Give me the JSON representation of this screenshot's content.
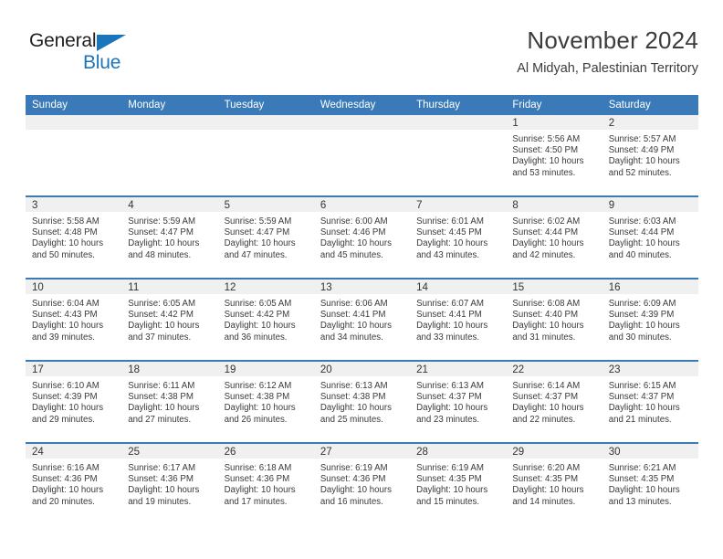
{
  "logo": {
    "word1": "General",
    "word2": "Blue",
    "triangle_color": "#1b75bb",
    "word1_color": "#231f20",
    "word2_color": "#1b75bb"
  },
  "header": {
    "month_title": "November 2024",
    "location": "Al Midyah, Palestinian Territory"
  },
  "theme": {
    "header_blue": "#3a7ab8",
    "daystrip_gray": "#f0f0f0",
    "text_color": "#3a3a3a"
  },
  "weekday_headers": [
    "Sunday",
    "Monday",
    "Tuesday",
    "Wednesday",
    "Thursday",
    "Friday",
    "Saturday"
  ],
  "weeks": [
    [
      {
        "day": "",
        "sunrise": "",
        "sunset": "",
        "daylight": "",
        "empty": true
      },
      {
        "day": "",
        "sunrise": "",
        "sunset": "",
        "daylight": "",
        "empty": true
      },
      {
        "day": "",
        "sunrise": "",
        "sunset": "",
        "daylight": "",
        "empty": true
      },
      {
        "day": "",
        "sunrise": "",
        "sunset": "",
        "daylight": "",
        "empty": true
      },
      {
        "day": "",
        "sunrise": "",
        "sunset": "",
        "daylight": "",
        "empty": true
      },
      {
        "day": "1",
        "sunrise": "Sunrise: 5:56 AM",
        "sunset": "Sunset: 4:50 PM",
        "daylight": "Daylight: 10 hours and 53 minutes.",
        "empty": false
      },
      {
        "day": "2",
        "sunrise": "Sunrise: 5:57 AM",
        "sunset": "Sunset: 4:49 PM",
        "daylight": "Daylight: 10 hours and 52 minutes.",
        "empty": false
      }
    ],
    [
      {
        "day": "3",
        "sunrise": "Sunrise: 5:58 AM",
        "sunset": "Sunset: 4:48 PM",
        "daylight": "Daylight: 10 hours and 50 minutes.",
        "empty": false
      },
      {
        "day": "4",
        "sunrise": "Sunrise: 5:59 AM",
        "sunset": "Sunset: 4:47 PM",
        "daylight": "Daylight: 10 hours and 48 minutes.",
        "empty": false
      },
      {
        "day": "5",
        "sunrise": "Sunrise: 5:59 AM",
        "sunset": "Sunset: 4:47 PM",
        "daylight": "Daylight: 10 hours and 47 minutes.",
        "empty": false
      },
      {
        "day": "6",
        "sunrise": "Sunrise: 6:00 AM",
        "sunset": "Sunset: 4:46 PM",
        "daylight": "Daylight: 10 hours and 45 minutes.",
        "empty": false
      },
      {
        "day": "7",
        "sunrise": "Sunrise: 6:01 AM",
        "sunset": "Sunset: 4:45 PM",
        "daylight": "Daylight: 10 hours and 43 minutes.",
        "empty": false
      },
      {
        "day": "8",
        "sunrise": "Sunrise: 6:02 AM",
        "sunset": "Sunset: 4:44 PM",
        "daylight": "Daylight: 10 hours and 42 minutes.",
        "empty": false
      },
      {
        "day": "9",
        "sunrise": "Sunrise: 6:03 AM",
        "sunset": "Sunset: 4:44 PM",
        "daylight": "Daylight: 10 hours and 40 minutes.",
        "empty": false
      }
    ],
    [
      {
        "day": "10",
        "sunrise": "Sunrise: 6:04 AM",
        "sunset": "Sunset: 4:43 PM",
        "daylight": "Daylight: 10 hours and 39 minutes.",
        "empty": false
      },
      {
        "day": "11",
        "sunrise": "Sunrise: 6:05 AM",
        "sunset": "Sunset: 4:42 PM",
        "daylight": "Daylight: 10 hours and 37 minutes.",
        "empty": false
      },
      {
        "day": "12",
        "sunrise": "Sunrise: 6:05 AM",
        "sunset": "Sunset: 4:42 PM",
        "daylight": "Daylight: 10 hours and 36 minutes.",
        "empty": false
      },
      {
        "day": "13",
        "sunrise": "Sunrise: 6:06 AM",
        "sunset": "Sunset: 4:41 PM",
        "daylight": "Daylight: 10 hours and 34 minutes.",
        "empty": false
      },
      {
        "day": "14",
        "sunrise": "Sunrise: 6:07 AM",
        "sunset": "Sunset: 4:41 PM",
        "daylight": "Daylight: 10 hours and 33 minutes.",
        "empty": false
      },
      {
        "day": "15",
        "sunrise": "Sunrise: 6:08 AM",
        "sunset": "Sunset: 4:40 PM",
        "daylight": "Daylight: 10 hours and 31 minutes.",
        "empty": false
      },
      {
        "day": "16",
        "sunrise": "Sunrise: 6:09 AM",
        "sunset": "Sunset: 4:39 PM",
        "daylight": "Daylight: 10 hours and 30 minutes.",
        "empty": false
      }
    ],
    [
      {
        "day": "17",
        "sunrise": "Sunrise: 6:10 AM",
        "sunset": "Sunset: 4:39 PM",
        "daylight": "Daylight: 10 hours and 29 minutes.",
        "empty": false
      },
      {
        "day": "18",
        "sunrise": "Sunrise: 6:11 AM",
        "sunset": "Sunset: 4:38 PM",
        "daylight": "Daylight: 10 hours and 27 minutes.",
        "empty": false
      },
      {
        "day": "19",
        "sunrise": "Sunrise: 6:12 AM",
        "sunset": "Sunset: 4:38 PM",
        "daylight": "Daylight: 10 hours and 26 minutes.",
        "empty": false
      },
      {
        "day": "20",
        "sunrise": "Sunrise: 6:13 AM",
        "sunset": "Sunset: 4:38 PM",
        "daylight": "Daylight: 10 hours and 25 minutes.",
        "empty": false
      },
      {
        "day": "21",
        "sunrise": "Sunrise: 6:13 AM",
        "sunset": "Sunset: 4:37 PM",
        "daylight": "Daylight: 10 hours and 23 minutes.",
        "empty": false
      },
      {
        "day": "22",
        "sunrise": "Sunrise: 6:14 AM",
        "sunset": "Sunset: 4:37 PM",
        "daylight": "Daylight: 10 hours and 22 minutes.",
        "empty": false
      },
      {
        "day": "23",
        "sunrise": "Sunrise: 6:15 AM",
        "sunset": "Sunset: 4:37 PM",
        "daylight": "Daylight: 10 hours and 21 minutes.",
        "empty": false
      }
    ],
    [
      {
        "day": "24",
        "sunrise": "Sunrise: 6:16 AM",
        "sunset": "Sunset: 4:36 PM",
        "daylight": "Daylight: 10 hours and 20 minutes.",
        "empty": false
      },
      {
        "day": "25",
        "sunrise": "Sunrise: 6:17 AM",
        "sunset": "Sunset: 4:36 PM",
        "daylight": "Daylight: 10 hours and 19 minutes.",
        "empty": false
      },
      {
        "day": "26",
        "sunrise": "Sunrise: 6:18 AM",
        "sunset": "Sunset: 4:36 PM",
        "daylight": "Daylight: 10 hours and 17 minutes.",
        "empty": false
      },
      {
        "day": "27",
        "sunrise": "Sunrise: 6:19 AM",
        "sunset": "Sunset: 4:36 PM",
        "daylight": "Daylight: 10 hours and 16 minutes.",
        "empty": false
      },
      {
        "day": "28",
        "sunrise": "Sunrise: 6:19 AM",
        "sunset": "Sunset: 4:35 PM",
        "daylight": "Daylight: 10 hours and 15 minutes.",
        "empty": false
      },
      {
        "day": "29",
        "sunrise": "Sunrise: 6:20 AM",
        "sunset": "Sunset: 4:35 PM",
        "daylight": "Daylight: 10 hours and 14 minutes.",
        "empty": false
      },
      {
        "day": "30",
        "sunrise": "Sunrise: 6:21 AM",
        "sunset": "Sunset: 4:35 PM",
        "daylight": "Daylight: 10 hours and 13 minutes.",
        "empty": false
      }
    ]
  ]
}
